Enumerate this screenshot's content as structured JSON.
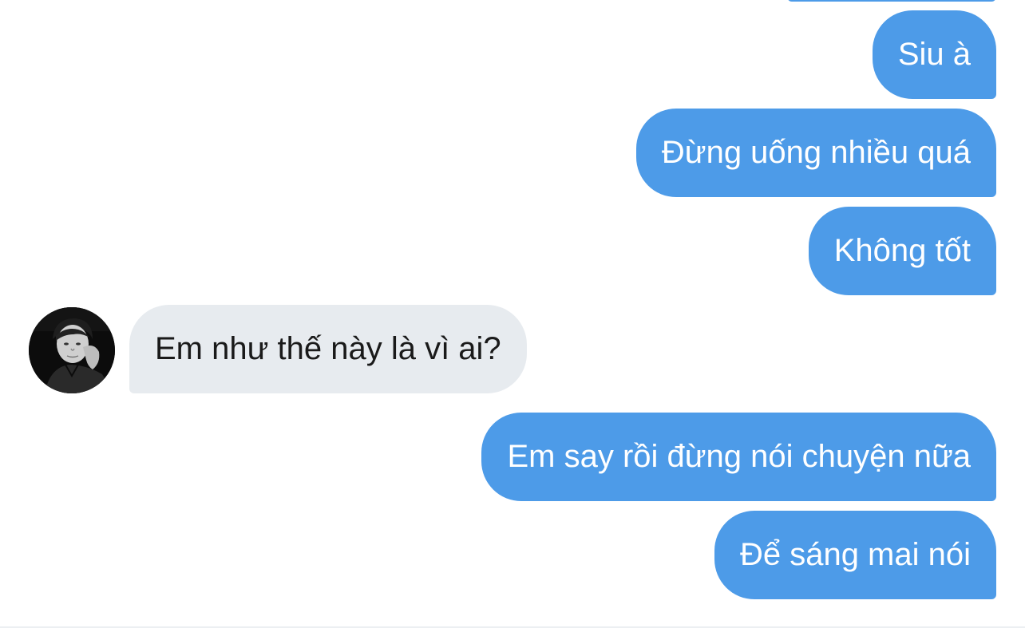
{
  "conversation": {
    "messages": [
      {
        "sender": "me",
        "text": "Siu à"
      },
      {
        "sender": "me",
        "text": "Đừng uống nhiều quá"
      },
      {
        "sender": "me",
        "text": "Không tốt"
      },
      {
        "sender": "contact",
        "text": "Em như thế này là vì ai?"
      },
      {
        "sender": "me",
        "text": "Em say rồi đừng nói chuyện nữa"
      },
      {
        "sender": "me",
        "text": "Để sáng mai nói"
      }
    ]
  },
  "contact": {
    "avatar_icon": "profile-photo-avatar"
  },
  "colors": {
    "outgoing_bubble": "#4d9be8",
    "incoming_bubble": "#e7ebef",
    "outgoing_text": "#ffffff",
    "incoming_text": "#1a1a1a"
  }
}
